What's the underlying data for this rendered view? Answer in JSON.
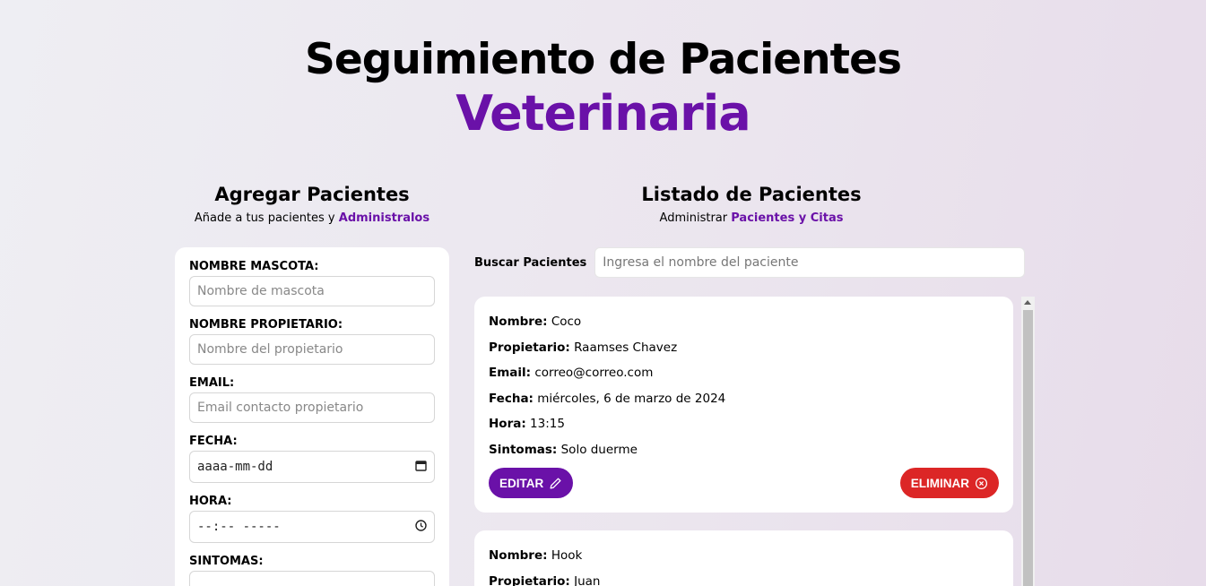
{
  "header": {
    "title_line1": "Seguimiento de Pacientes",
    "title_line2": "Veterinaria"
  },
  "form_section": {
    "title": "Agregar Pacientes",
    "subtitle_prefix": "Añade a tus pacientes y ",
    "subtitle_highlight": "Administralos",
    "fields": {
      "pet_name": {
        "label": "NOMBRE MASCOTA:",
        "placeholder": "Nombre de mascota"
      },
      "owner": {
        "label": "NOMBRE PROPIETARIO:",
        "placeholder": "Nombre del propietario"
      },
      "email": {
        "label": "EMAIL:",
        "placeholder": "Email contacto propietario"
      },
      "date": {
        "label": "FECHA:",
        "placeholder": "aaaa-mm-dd"
      },
      "time": {
        "label": "HORA:",
        "placeholder": "--:-- -----"
      },
      "symptoms": {
        "label": "SINTOMAS:"
      }
    }
  },
  "list_section": {
    "title": "Listado de Pacientes",
    "subtitle_prefix": "Administrar ",
    "subtitle_highlight": "Pacientes y Citas",
    "search": {
      "label": "Buscar Pacientes",
      "placeholder": "Ingresa el nombre del paciente"
    },
    "labels": {
      "name": "Nombre:",
      "owner": "Propietario:",
      "email": "Email:",
      "date": "Fecha:",
      "time": "Hora:",
      "symptoms": "Sintomas:"
    },
    "edit_label": "EDITAR",
    "delete_label": "ELIMINAR",
    "patients": [
      {
        "name": "Coco",
        "owner": "Raamses Chavez",
        "email": "correo@correo.com",
        "date": "miércoles, 6 de marzo de 2024",
        "time": "13:15",
        "symptoms": "Solo duerme"
      },
      {
        "name": "Hook",
        "owner": "Juan"
      }
    ]
  },
  "colors": {
    "accent": "#6a11a8",
    "danger": "#dc2626"
  }
}
